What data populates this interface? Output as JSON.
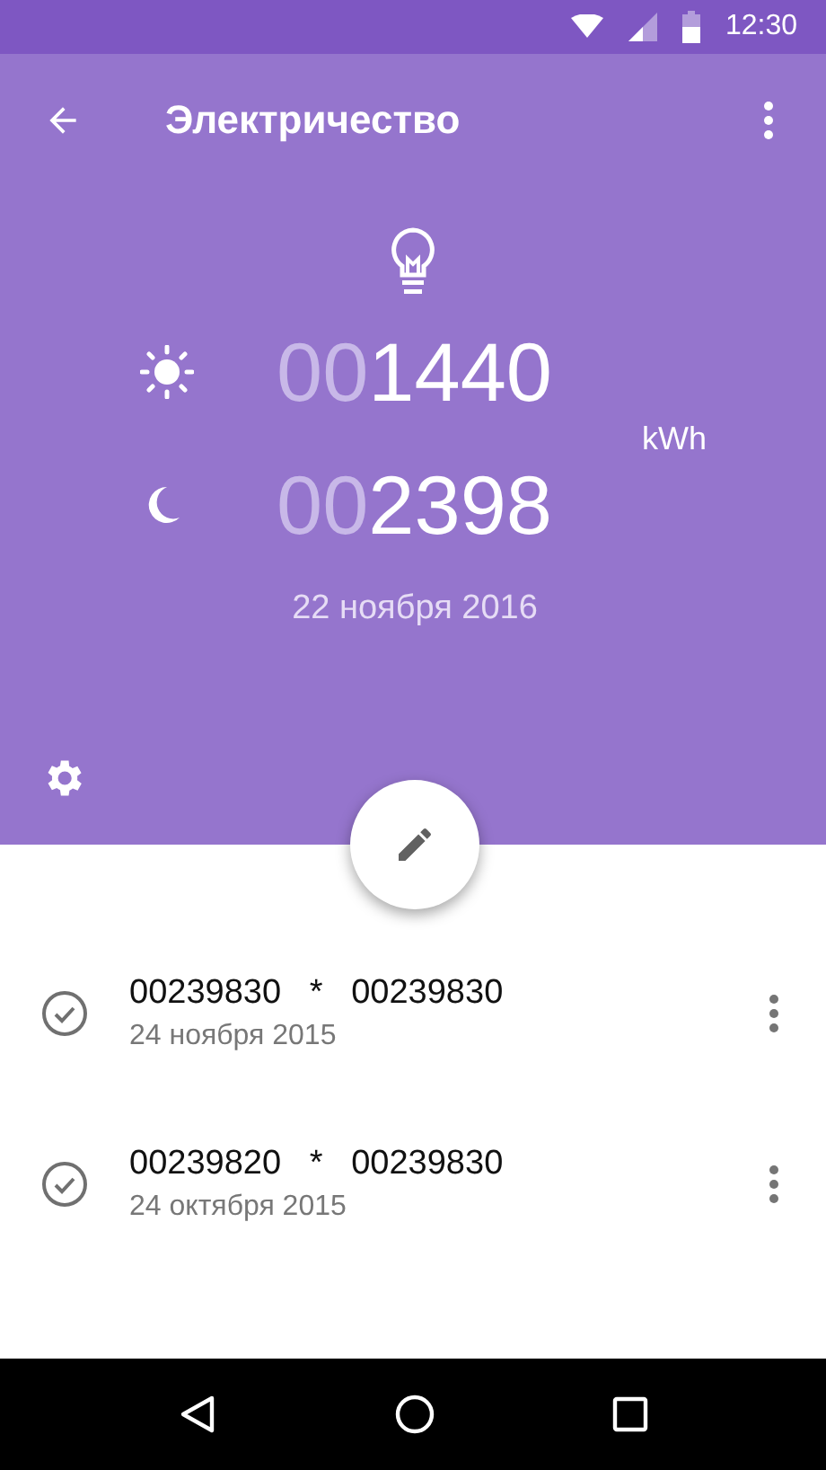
{
  "status_bar": {
    "time": "12:30"
  },
  "toolbar": {
    "title": "Электричество"
  },
  "readings": [
    {
      "kind": "day",
      "lead": "00",
      "value": "1440"
    },
    {
      "kind": "night",
      "lead": "00",
      "value": "2398"
    }
  ],
  "unit": "kWh",
  "date": "22 ноября 2016",
  "history": [
    {
      "values": "00239830   *   00239830",
      "date": "24 ноября 2015",
      "checked": true
    },
    {
      "values": "00239820   *   00239830",
      "date": "24 октября 2015",
      "checked": true
    }
  ]
}
